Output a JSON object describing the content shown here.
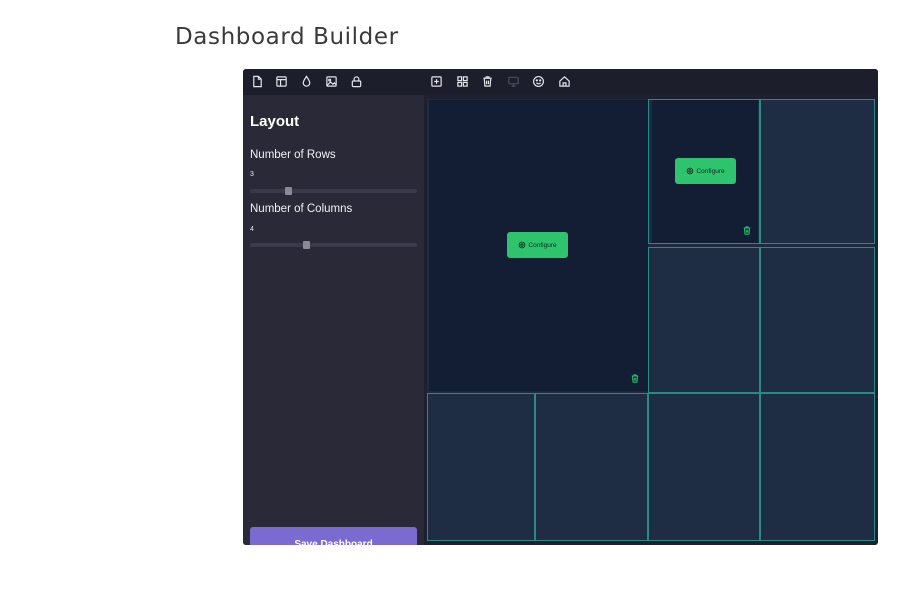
{
  "page": {
    "title": "Dashboard Builder"
  },
  "toolbar": {
    "left_icons": [
      "file-icon",
      "layout-icon",
      "droplet-icon",
      "image-icon",
      "lock-icon"
    ],
    "right_icons": [
      "add-square-icon",
      "grid-icon",
      "trash-icon",
      "monitor-icon",
      "smiley-icon",
      "home-icon"
    ]
  },
  "sidebar": {
    "title": "Layout",
    "rows": {
      "label": "Number of Rows",
      "value": "3",
      "fraction": 0.22
    },
    "columns": {
      "label": "Number of Columns",
      "value": "4",
      "fraction": 0.33
    },
    "save_label": "Save Dashboard"
  },
  "widgets": [
    {
      "configure_label": "Configure"
    },
    {
      "configure_label": "Configure"
    }
  ],
  "colors": {
    "accent_green": "#2ec46e",
    "save_purple": "#7b6bd0",
    "grid_line": "#2a8a88",
    "widget_bg": "#131d33",
    "sidebar_bg": "#2a2937"
  }
}
